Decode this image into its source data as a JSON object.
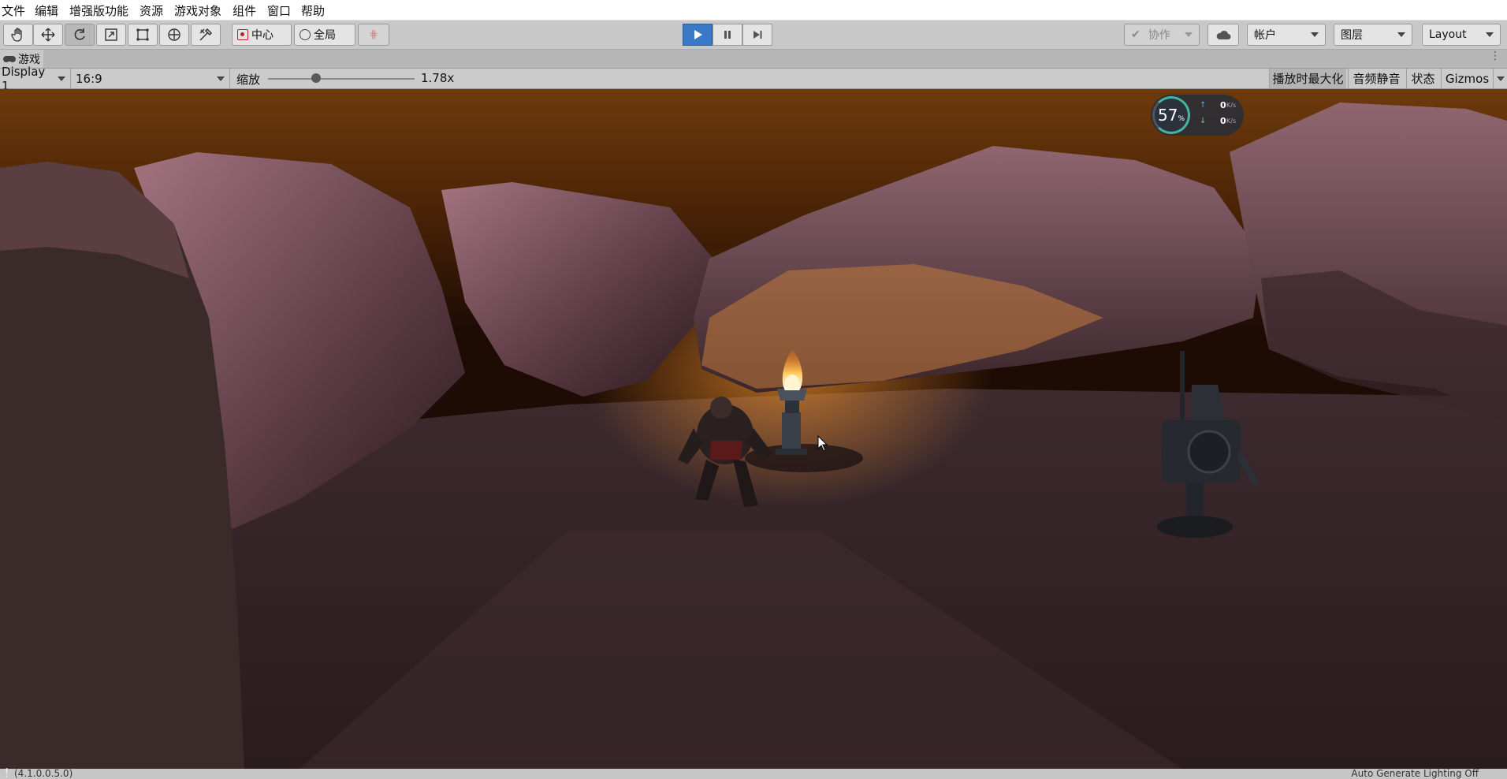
{
  "menu": [
    "文件",
    "编辑",
    "增强版功能",
    "资源",
    "游戏对象",
    "组件",
    "窗口",
    "帮助"
  ],
  "toolbar": {
    "tools": [
      {
        "icon": "hand-tool-icon"
      },
      {
        "icon": "move-tool-icon"
      },
      {
        "icon": "rotate-tool-icon"
      },
      {
        "icon": "scale-tool-icon"
      },
      {
        "icon": "rect-tool-icon"
      },
      {
        "icon": "transform-tool-icon"
      },
      {
        "icon": "custom-tool-icon"
      }
    ],
    "pivot_label": "中心",
    "space_label": "全局",
    "collab_label": "协作",
    "account_label": "帐户",
    "layers_label": "图层",
    "layout_label": "Layout"
  },
  "tab": {
    "title": "游戏"
  },
  "gamebar": {
    "display": "Display 1",
    "aspect": "16:9",
    "scale_label": "缩放",
    "scale_value": "1.78x",
    "scale_fraction": 0.33,
    "maximize_on_play": "播放时最大化",
    "mute_audio": "音频静音",
    "stats": "状态",
    "gizmos": "Gizmos"
  },
  "overlay": {
    "percent": "57",
    "percent_unit": "%",
    "up_value": "0",
    "down_value": "0",
    "rate_unit": "K/s"
  },
  "status": {
    "left": "(4.1.0.0.5.0)",
    "right": "Auto Generate Lighting Off"
  },
  "colors": {
    "accent": "#3a79c8",
    "sky_top": "#6e3a0c",
    "rock": "#8a5e68",
    "fire": "#ffb030"
  }
}
